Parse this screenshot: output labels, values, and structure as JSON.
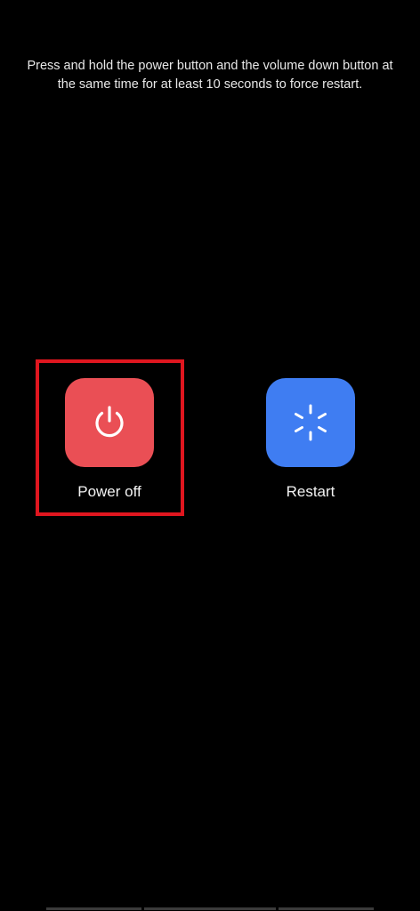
{
  "instruction": "Press and hold the power button and the volume down button at the same time for at least 10 seconds to force restart.",
  "actions": [
    {
      "label": "Power off",
      "icon": "power-icon",
      "color": "#ea4f55",
      "highlighted": true
    },
    {
      "label": "Restart",
      "icon": "restart-icon",
      "color": "#3f7df2",
      "highlighted": false
    }
  ],
  "colors": {
    "background": "#000000",
    "highlight": "#e0161f"
  }
}
